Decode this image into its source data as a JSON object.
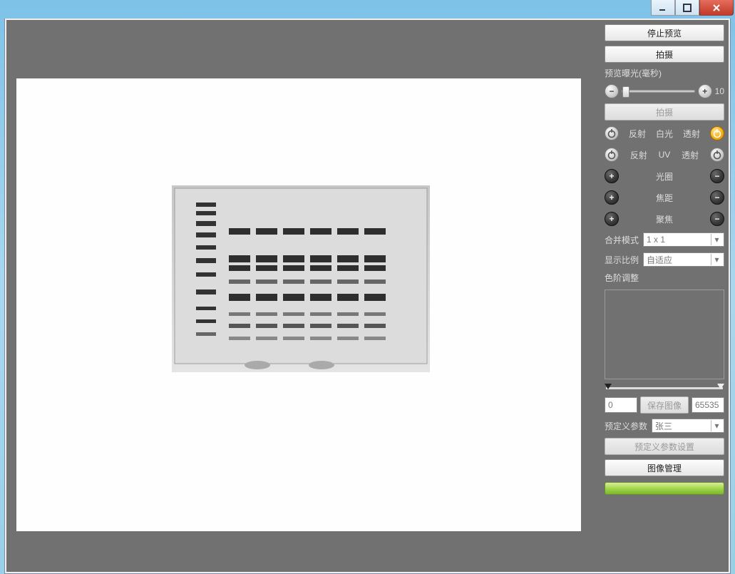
{
  "titlebar": {
    "minimize": "minimize",
    "maximize": "maximize",
    "close": "close"
  },
  "panel": {
    "stop_preview": "停止预览",
    "capture": "拍摄",
    "preview_exposure_label": "预览曝光(毫秒)",
    "preview_exposure_value": "10",
    "capture_disabled": "拍摄",
    "light_white": {
      "reflect": "反射",
      "mode": "白光",
      "transmit": "透射"
    },
    "light_uv": {
      "reflect": "反射",
      "mode": "UV",
      "transmit": "透射"
    },
    "aperture": "光圈",
    "focal": "焦距",
    "focus": "聚焦",
    "merge_mode_label": "合并模式",
    "merge_mode_value": "1 x 1",
    "display_ratio_label": "显示比例",
    "display_ratio_value": "自适应",
    "tone_adjust_label": "色阶调整",
    "histo_min": "0",
    "save_image": "保存图像",
    "histo_max": "65535",
    "preset_label": "预定义参数",
    "preset_value": "张三",
    "preset_settings": "预定义参数设置",
    "image_manage": "图像管理"
  }
}
